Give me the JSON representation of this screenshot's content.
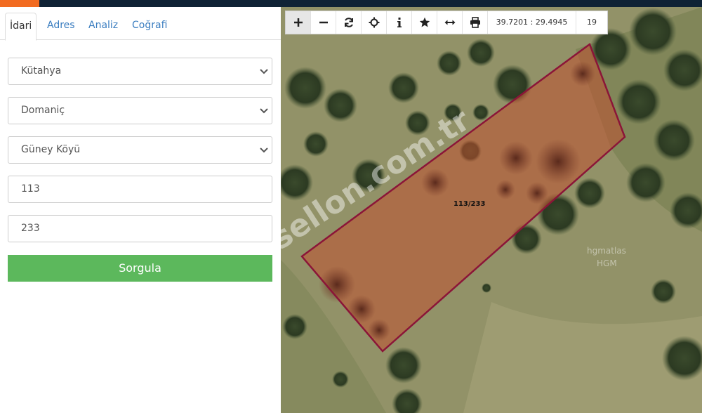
{
  "tabs": [
    {
      "label": "İdari"
    },
    {
      "label": "Adres"
    },
    {
      "label": "Analiz"
    },
    {
      "label": "Coğrafi"
    }
  ],
  "form": {
    "province": "Kütahya",
    "district": "Domaniç",
    "village": "Güney Köyü",
    "block": "113",
    "parcel": "233",
    "submit_label": "Sorgula"
  },
  "toolbar": {
    "icons": [
      "zoom-in-icon",
      "zoom-out-icon",
      "refresh-icon",
      "locate-icon",
      "info-icon",
      "star-icon",
      "measure-icon",
      "print-icon"
    ],
    "coordinates": "39.7201 : 29.4945",
    "zoom_level": "19"
  },
  "map": {
    "parcel_label": "113/233",
    "watermark": "sellon.com.tr",
    "attribution_line1": "hgmatlas",
    "attribution_line2": "HGM",
    "parcel_stroke": "#8b1538",
    "parcel_fill": "#c0502f"
  }
}
